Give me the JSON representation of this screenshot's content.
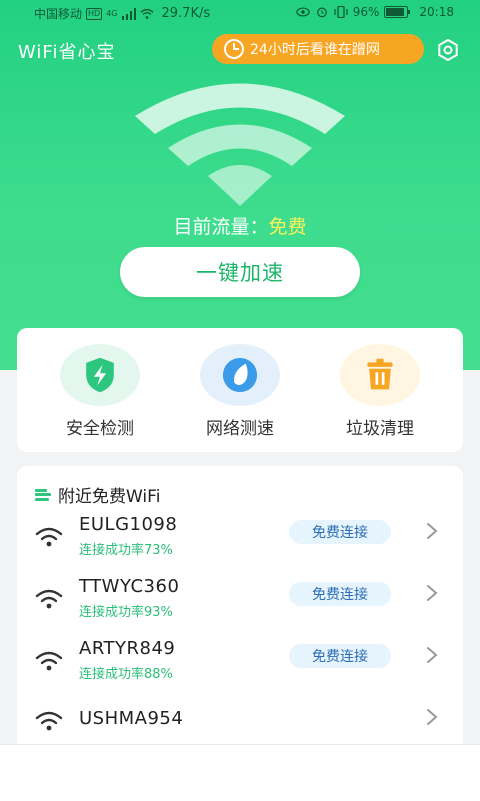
{
  "status_bar": {
    "carrier": "中国移动",
    "hd_badge": "HD",
    "network": "4G",
    "speed": "29.7K/s",
    "battery": "96%",
    "battery_level": 0.96,
    "time": "20:18"
  },
  "header": {
    "app_title": "WiFi省心宝",
    "promo_label": "24小时后看谁在蹭网",
    "icons": [
      "clock-icon",
      "settings-icon"
    ]
  },
  "hero": {
    "flow_label": "目前流量：",
    "flow_value": "免费",
    "boost_label": "一键加速"
  },
  "tools": [
    {
      "label": "安全检测",
      "icon": "shield-bolt-icon",
      "bg": "#e3f7ee",
      "color": "#2cc67e"
    },
    {
      "label": "网络测速",
      "icon": "speed-drop-icon",
      "bg": "#e3f0fb",
      "color": "#3b9be8"
    },
    {
      "label": "垃圾清理",
      "icon": "trash-icon",
      "bg": "#fff5e0",
      "color": "#f6a623"
    }
  ],
  "wifi_list": {
    "title": "附近免费WiFi",
    "connect_label": "免费连接",
    "items": [
      {
        "ssid": "EULG1098",
        "rate": "连接成功率73%"
      },
      {
        "ssid": "TTWYC360",
        "rate": "连接成功率93%"
      },
      {
        "ssid": "ARTYR849",
        "rate": "连接成功率88%"
      },
      {
        "ssid": "USHMA954",
        "rate": ""
      }
    ]
  },
  "colors": {
    "brand_green": "#2cc67e",
    "promo_orange": "#f6a623",
    "flow_highlight": "#fff35a"
  }
}
